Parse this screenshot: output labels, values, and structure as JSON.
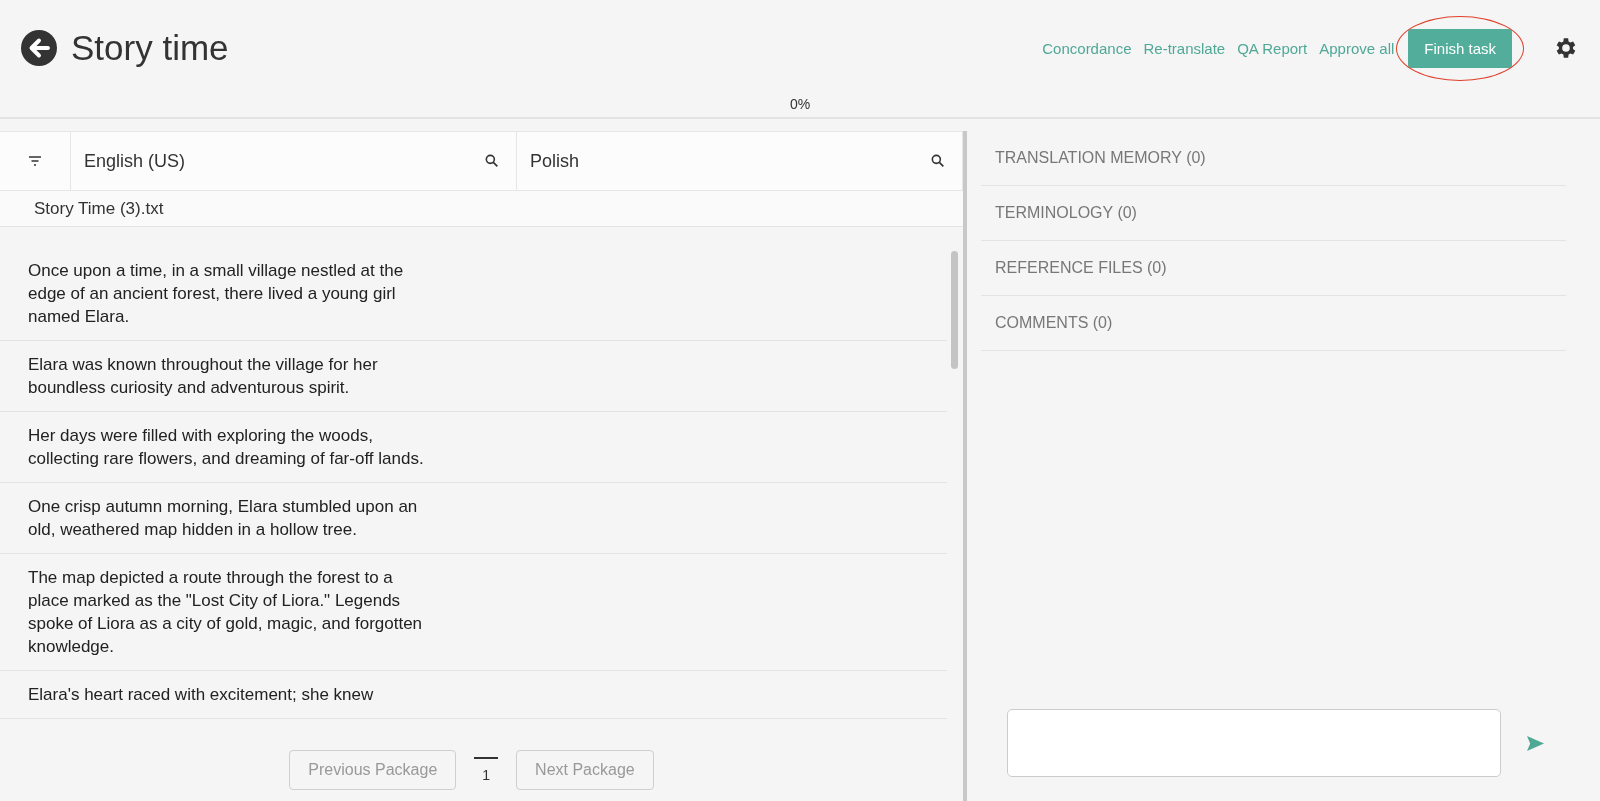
{
  "header": {
    "title": "Story time",
    "links": [
      "Concordance",
      "Re-translate",
      "QA Report",
      "Approve all"
    ],
    "finish_button": {
      "label": "Finish task",
      "highlighted": true
    }
  },
  "progress": {
    "label": "0%"
  },
  "editor": {
    "columns": [
      "English (US)",
      "Polish"
    ],
    "file": "Story Time (3).txt",
    "segments": [
      {
        "source": "Once upon a time, in a small village nestled at the edge of an ancient forest, there lived a young girl named Elara."
      },
      {
        "source": "Elara was known throughout the village for her boundless curiosity and adventurous spirit."
      },
      {
        "source": "Her days were filled with exploring the woods, collecting rare flowers, and dreaming of far-off lands."
      },
      {
        "source": "One crisp autumn morning, Elara stumbled upon an old, weathered map hidden in a hollow tree."
      },
      {
        "source": "The map depicted a route through the forest to a place marked as the \"Lost City of Liora.\" Legends spoke of Liora as a city of gold, magic, and forgotten knowledge."
      },
      {
        "source": "Elara's heart raced with excitement; she knew"
      }
    ],
    "pagination": {
      "previous": "Previous Package",
      "page": "1",
      "next": "Next Package"
    }
  },
  "side_panel": {
    "sections": [
      "TRANSLATION MEMORY (0)",
      "TERMINOLOGY (0)",
      "REFERENCE FILES (0)",
      "COMMENTS (0)"
    ]
  }
}
